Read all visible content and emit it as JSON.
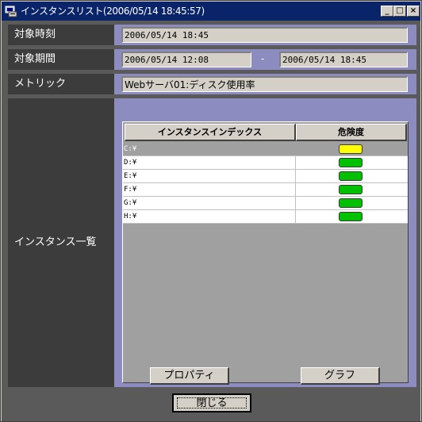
{
  "window": {
    "title": "インスタンスリスト(2006/05/14 18:45:57)",
    "controls": {
      "minimize": "_",
      "maximize": "□",
      "close": "×"
    }
  },
  "target_time": {
    "label": "対象時刻",
    "value": "2006/05/14 18:45"
  },
  "target_period": {
    "label": "対象期間",
    "start": "2006/05/14 12:08",
    "separator": "-",
    "end": "2006/05/14 18:45"
  },
  "metric": {
    "label": "メトリック",
    "value": "Webサーバ01:ディスク使用率"
  },
  "instance_list": {
    "label": "インスタンス一覧",
    "columns": [
      "インスタンスインデックス",
      "危険度"
    ],
    "rows": [
      {
        "name": "C:¥",
        "risk": "yellow",
        "color": "#ffff00"
      },
      {
        "name": "D:¥",
        "risk": "green",
        "color": "#00c000"
      },
      {
        "name": "E:¥",
        "risk": "green",
        "color": "#00c000"
      },
      {
        "name": "F:¥",
        "risk": "green",
        "color": "#00c000"
      },
      {
        "name": "G:¥",
        "risk": "green",
        "color": "#00c000"
      },
      {
        "name": "H:¥",
        "risk": "green",
        "color": "#00c000"
      }
    ]
  },
  "buttons": {
    "properties": "プロパティ",
    "graph": "グラフ",
    "close": "閉じる"
  }
}
